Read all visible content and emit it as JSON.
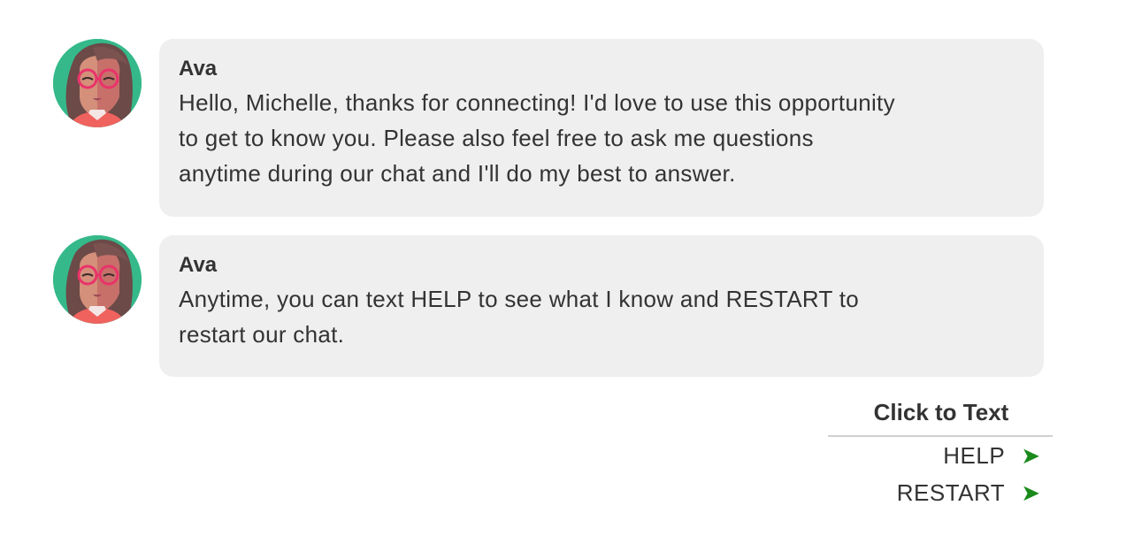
{
  "messages": [
    {
      "sender": "Ava",
      "text": "Hello, Michelle, thanks for connecting! I'd love to use this opportunity\nto get to know you. Please also feel free to ask me questions\nanytime during our chat and I'll do my best to answer."
    },
    {
      "sender": "Ava",
      "text": "Anytime, you can text HELP to see what I know and RESTART to\nrestart our chat."
    }
  ],
  "click_to_text": {
    "title": "Click to Text",
    "options": [
      {
        "label": "HELP",
        "icon": "send-arrow-icon"
      },
      {
        "label": "RESTART",
        "icon": "send-arrow-icon"
      }
    ]
  },
  "colors": {
    "accent": "#1a8a1a",
    "bubble": "#efefef",
    "avatar_bg": "#35b98a"
  }
}
